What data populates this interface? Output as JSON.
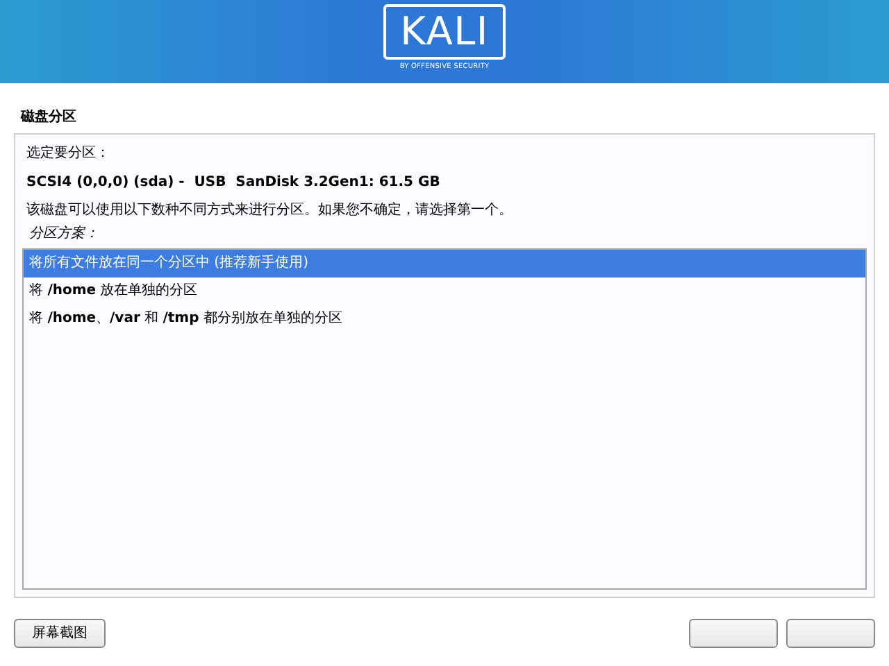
{
  "header": {
    "logo_text": "KALI",
    "tagline": "BY OFFENSIVE SECURITY"
  },
  "page_title": "磁盘分区",
  "prompt": "选定要分区：",
  "disk": "SCSI4 (0,0,0) (sda) -  USB  SanDisk 3.2Gen1: 61.5 GB",
  "description": "该磁盘可以使用以下数种不同方式来进行分区。如果您不确定，请选择第一个。",
  "scheme_label": "分区方案：",
  "options": [
    {
      "label": "将所有文件放在同一个分区中 (推荐新手使用)",
      "selected": true
    },
    {
      "label": "将 **/home** 放在单独的分区",
      "selected": false
    },
    {
      "label": "将 **/home**、**/var** 和 **/tmp** 都分别放在单独的分区",
      "selected": false
    }
  ],
  "buttons": [
    {
      "kind": "labeled",
      "label": "屏幕截图"
    }
  ],
  "wizard_buttons": [
    {
      "kind": "blank"
    },
    {
      "kind": "blank"
    }
  ]
}
